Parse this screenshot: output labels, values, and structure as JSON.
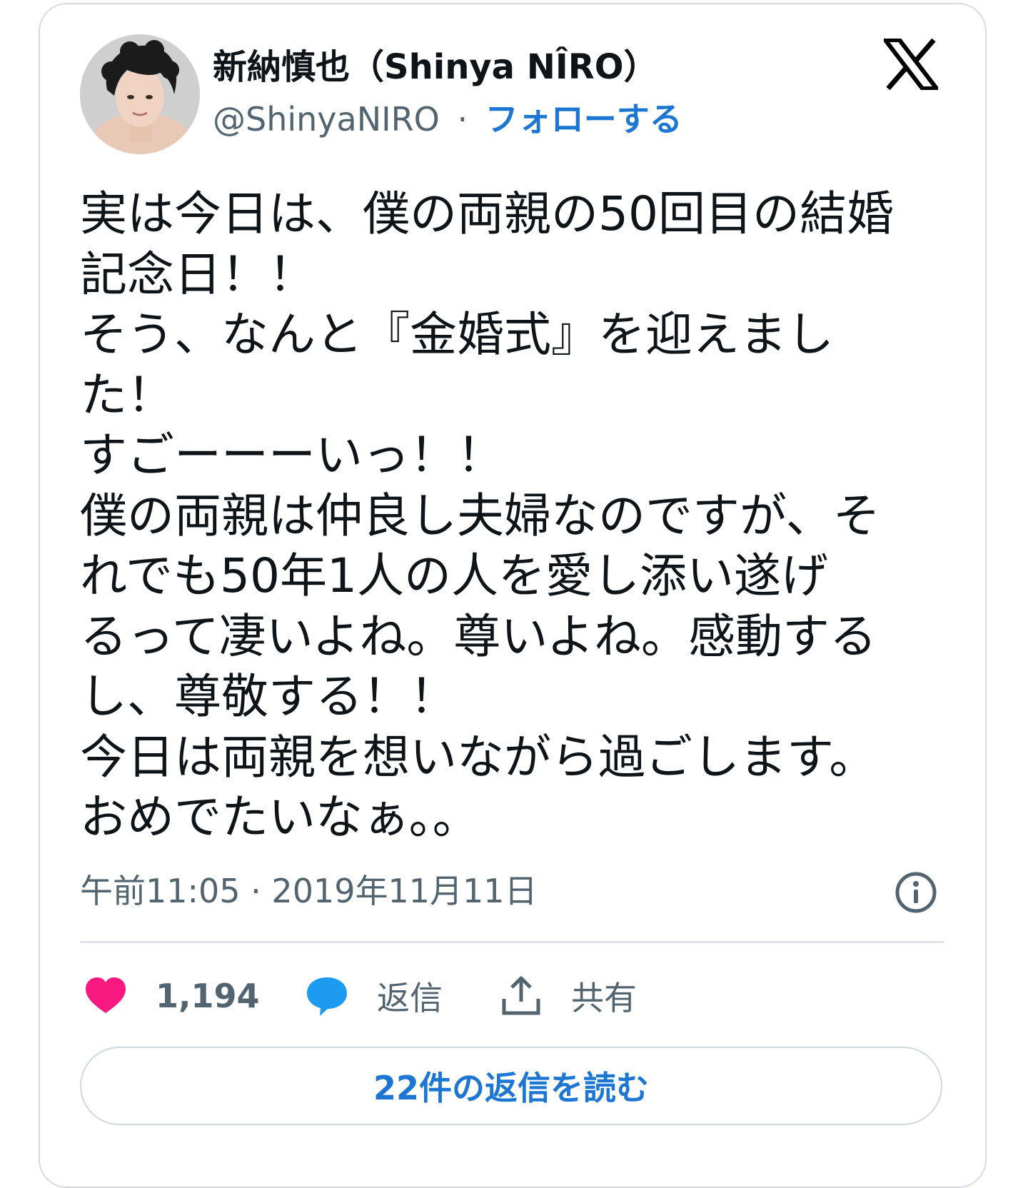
{
  "author": {
    "display_name": "新納慎也（Shinya NÎRO）",
    "handle": "@ShinyaNIRO",
    "separator": "·",
    "follow_label": "フォローする"
  },
  "brand": {
    "logo_icon": "x-logo-icon"
  },
  "tweet": {
    "lines": [
      "実は今日は、僕の両親の50回目の結婚",
      "記念日！！",
      "そう、なんと『金婚式』を迎えまし",
      "た！",
      "すごーーーいっ！！",
      "僕の両親は仲良し夫婦なのですが、そ",
      "れでも50年1人の人を愛し添い遂げ",
      "るって凄いよね。尊いよね。感動する",
      "し、尊敬する！！",
      "今日は両親を想いながら過ごします。",
      "おめでたいなぁ。。"
    ],
    "timestamp": "午前11:05 · 2019年11月11日"
  },
  "actions": {
    "like_count": "1,194",
    "reply_label": "返信",
    "share_label": "共有"
  },
  "read_replies_label": "22件の返信を読む",
  "colors": {
    "accent": "#1d77d2",
    "like": "#f91880",
    "reply_bubble": "#1d9bf0",
    "muted": "#536471",
    "text": "#0f1419"
  }
}
